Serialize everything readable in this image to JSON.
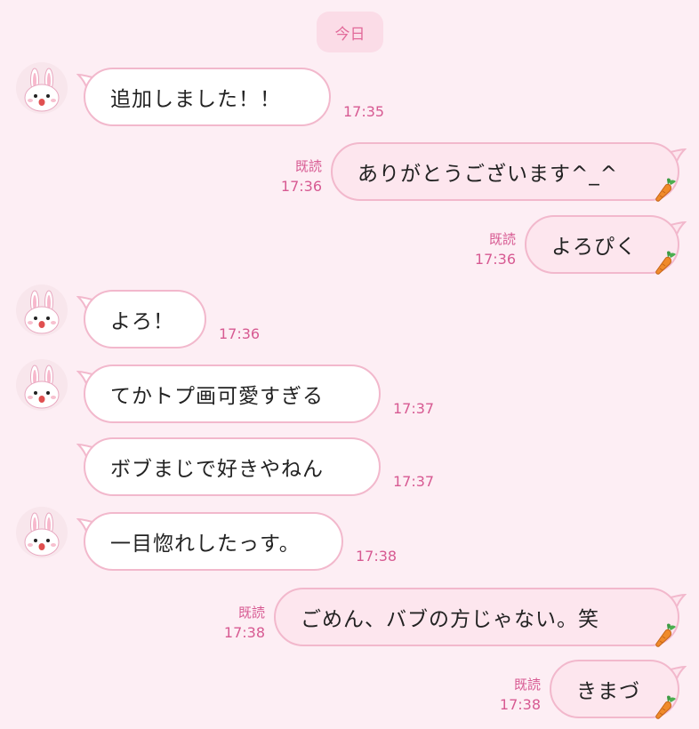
{
  "date_label": "今日",
  "messages": [
    {
      "text": "追加しました！！",
      "time": "17:35"
    },
    {
      "text": "ありがとうございます^_^",
      "time": "17:36",
      "read": "既読"
    },
    {
      "text": "よろぴく",
      "time": "17:36",
      "read": "既読"
    },
    {
      "text": "よろ！",
      "time": "17:36"
    },
    {
      "text": "てかトプ画可愛すぎる",
      "time": "17:37"
    },
    {
      "text": "ボブまじで好きやねん",
      "time": "17:37"
    },
    {
      "text": "一目惚れしたっす。",
      "time": "17:38"
    },
    {
      "text": "ごめん、バブの方じゃない。笑",
      "time": "17:38",
      "read": "既読"
    },
    {
      "text": "きまづ",
      "time": "17:38",
      "read": "既読"
    }
  ],
  "colors": {
    "background": "#fdeef4",
    "bubble_border": "#f2b8cc",
    "accent_text": "#d75a92"
  },
  "icons": {
    "avatar": "bunny-avatar-icon",
    "sticker": "carrot-icon"
  }
}
